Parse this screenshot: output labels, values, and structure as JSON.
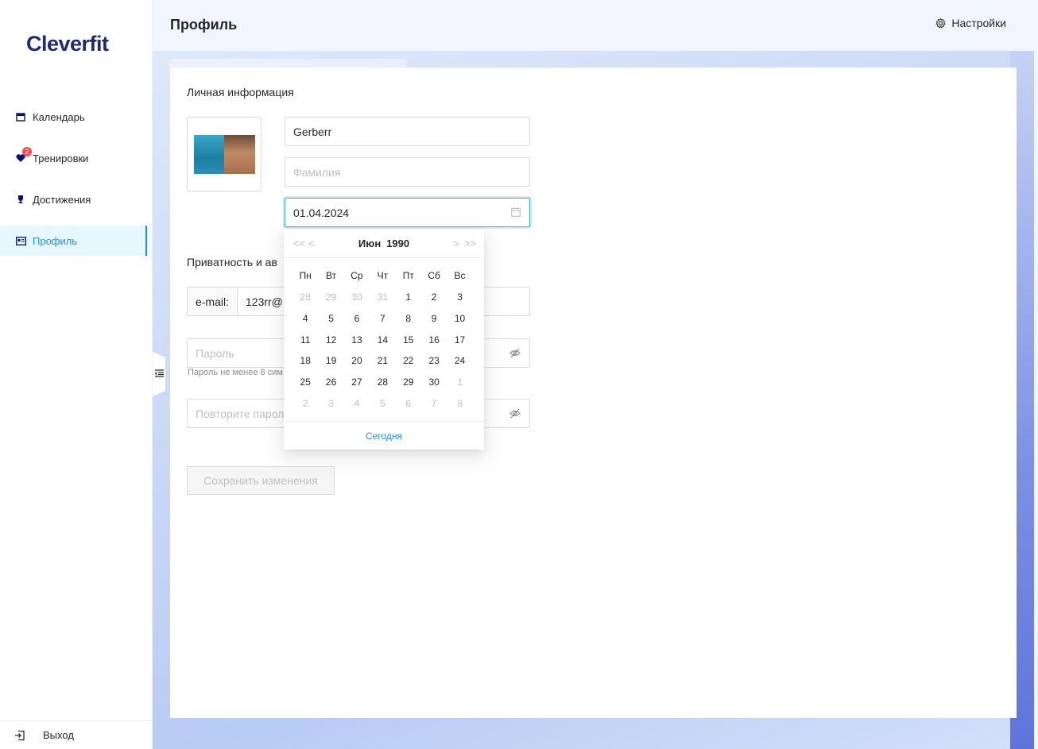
{
  "app": {
    "logo": "Cleverfit"
  },
  "sidebar": {
    "items": [
      {
        "label": "Календарь",
        "icon": "calendar-icon"
      },
      {
        "label": "Тренировки",
        "icon": "heart-icon",
        "badge": "2"
      },
      {
        "label": "Достижения",
        "icon": "trophy-icon"
      },
      {
        "label": "Профиль",
        "icon": "profile-card-icon",
        "active": true
      }
    ],
    "logout": "Выход"
  },
  "header": {
    "title": "Профиль",
    "settings_label": "Настройки"
  },
  "profile": {
    "personal_title": "Личная информация",
    "first_name": "Gerberr",
    "last_name_placeholder": "Фамилия",
    "birth_date": "01.04.2024",
    "privacy_title": "Приватность и ав",
    "email_addon": "e-mail:",
    "email_value": "123rr@",
    "password_placeholder": "Пароль",
    "password_hint": "Пароль не менее 8 сим",
    "repeat_password_placeholder": "Повторите парол",
    "save_label": "Сохранить изменения"
  },
  "datepicker": {
    "month": "Июн",
    "year": "1990",
    "nav_super_prev": "<<",
    "nav_prev": "<",
    "nav_next": ">",
    "nav_super_next": ">>",
    "weekdays": [
      "Пн",
      "Вт",
      "Ср",
      "Чт",
      "Пт",
      "Сб",
      "Вс"
    ],
    "days": [
      [
        "28",
        "29",
        "30",
        "31",
        "1",
        "2",
        "3"
      ],
      [
        "4",
        "5",
        "6",
        "7",
        "8",
        "9",
        "10"
      ],
      [
        "11",
        "12",
        "13",
        "14",
        "15",
        "16",
        "17"
      ],
      [
        "18",
        "19",
        "20",
        "21",
        "22",
        "23",
        "24"
      ],
      [
        "25",
        "26",
        "27",
        "28",
        "29",
        "30",
        "1"
      ],
      [
        "2",
        "3",
        "4",
        "5",
        "6",
        "7",
        "8"
      ]
    ],
    "out_of_month": [
      [
        true,
        true,
        true,
        true,
        false,
        false,
        false
      ],
      [
        false,
        false,
        false,
        false,
        false,
        false,
        false
      ],
      [
        false,
        false,
        false,
        false,
        false,
        false,
        false
      ],
      [
        false,
        false,
        false,
        false,
        false,
        false,
        false
      ],
      [
        false,
        false,
        false,
        false,
        false,
        false,
        true
      ],
      [
        true,
        true,
        true,
        true,
        true,
        true,
        true
      ]
    ],
    "today_label": "Сегодня"
  },
  "colors": {
    "accent": "#1890ff",
    "brand": "#1e2a78",
    "badge": "#ff4d4f"
  }
}
